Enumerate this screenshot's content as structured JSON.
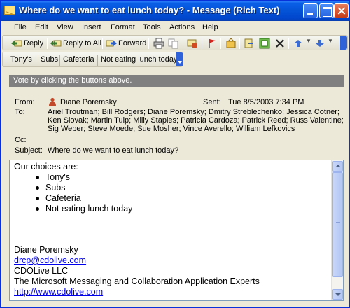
{
  "window": {
    "title": "Where do we want to eat lunch today? - Message (Rich Text)"
  },
  "menu": [
    "File",
    "Edit",
    "View",
    "Insert",
    "Format",
    "Tools",
    "Actions",
    "Help"
  ],
  "toolbar": {
    "reply_label": "Reply",
    "reply_all_label": "Reply to All",
    "forward_label": "Forward",
    "icons": [
      "print-icon",
      "copy-icon",
      "flag-icon",
      "delete-icon",
      "previous-icon",
      "next-icon"
    ]
  },
  "voting": {
    "buttons": [
      "Tony's",
      "Subs",
      "Cafeteria",
      "Not eating lunch today"
    ]
  },
  "infobar": {
    "text": "Vote by clicking the buttons above."
  },
  "header": {
    "from_label": "From:",
    "from_value": "Diane Poremsky",
    "sent_label": "Sent:",
    "sent_value": "Tue 8/5/2003 7:34 PM",
    "to_label": "To:",
    "to_lines": [
      "Ariel Troutman; Bill Rodgers; Diane Poremsky; Dmitry Streblechenko; Jessica Cotner;",
      "Ken Slovak; Martin Tuip; Milly Staples; Patricia Cardoza; Patrick Reed; Russ Valentine;",
      "Sig Weber; Steve Moede; Sue Mosher; Vince Averello; William Lefkovics"
    ],
    "cc_label": "Cc:",
    "subject_label": "Subject:",
    "subject_value": "Where do we want to eat lunch today?"
  },
  "body": {
    "intro": "Our choices are:",
    "choices": [
      "Tony's",
      "Subs",
      "Cafeteria",
      "Not eating lunch today"
    ],
    "signature_name": "Diane Poremsky",
    "signature_email": "drcp@cdolive.com",
    "signature_company": "CDOLive LLC",
    "signature_tagline": "The Microsoft Messaging and Collaboration Application Experts",
    "signature_url": "http://www.cdolive.com"
  },
  "colors": {
    "titlebar": "#0453D6",
    "window_face": "#ECE9D8",
    "link": "#0000EE",
    "infobar": "#808080"
  }
}
